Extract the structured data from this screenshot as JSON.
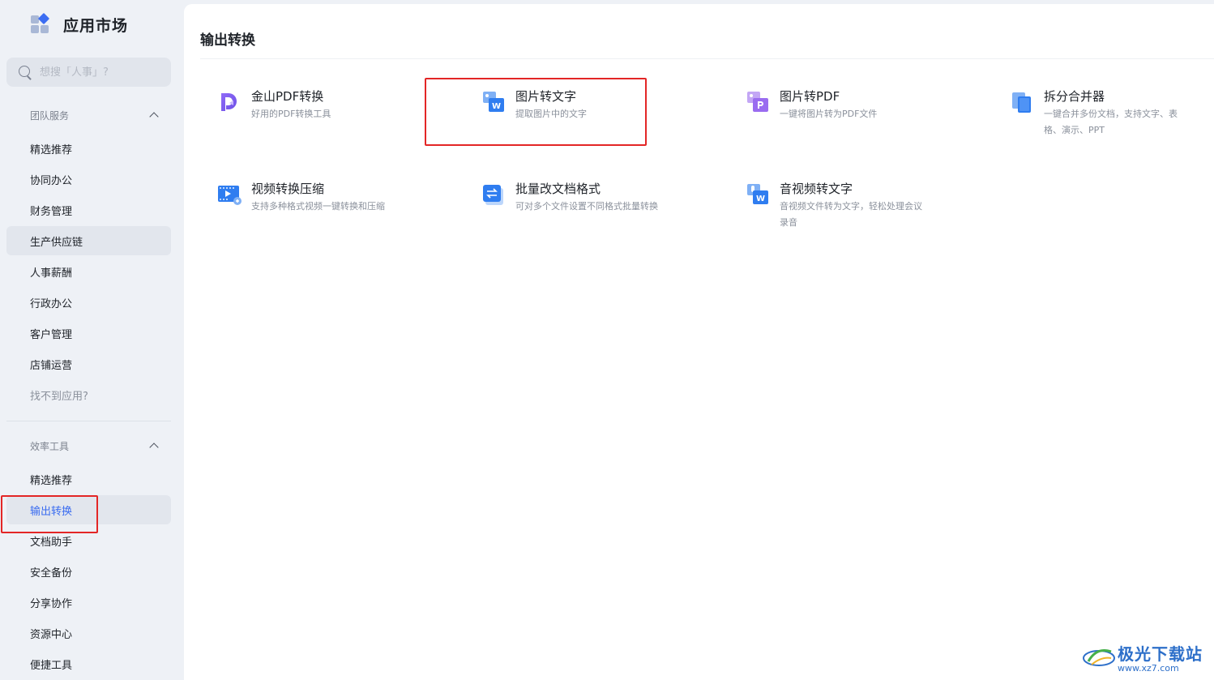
{
  "app": {
    "title": "应用市场"
  },
  "search": {
    "placeholder": "想搜「人事」?"
  },
  "sidebar": {
    "team_group": {
      "title": "团队服务",
      "items": [
        {
          "label": "精选推荐"
        },
        {
          "label": "协同办公"
        },
        {
          "label": "财务管理"
        },
        {
          "label": "生产供应链"
        },
        {
          "label": "人事薪酬"
        },
        {
          "label": "行政办公"
        },
        {
          "label": "客户管理"
        },
        {
          "label": "店铺运营"
        },
        {
          "label": "找不到应用?"
        }
      ]
    },
    "tools_group": {
      "title": "效率工具",
      "items": [
        {
          "label": "精选推荐"
        },
        {
          "label": "输出转换"
        },
        {
          "label": "文档助手"
        },
        {
          "label": "安全备份"
        },
        {
          "label": "分享协作"
        },
        {
          "label": "资源中心"
        },
        {
          "label": "便捷工具"
        }
      ]
    }
  },
  "main": {
    "title": "输出转换",
    "tools": [
      {
        "name": "金山PDF转换",
        "desc_lines": [
          "好用的PDF转换工具"
        ],
        "icon": "pdf-convert-icon"
      },
      {
        "name": "图片转文字",
        "desc_lines": [
          "提取图片中的文字"
        ],
        "icon": "image-to-text-icon"
      },
      {
        "name": "图片转PDF",
        "desc_lines": [
          "一键将图片转为PDF文件"
        ],
        "icon": "image-to-pdf-icon"
      },
      {
        "name": "拆分合并器",
        "desc_lines": [
          "一键合并多份文档，支持文字、表",
          "格、演示、PPT"
        ],
        "icon": "split-merge-icon"
      },
      {
        "name": "视频转换压缩",
        "desc_lines": [
          "支持多种格式视频一键转换和压缩"
        ],
        "icon": "video-convert-icon"
      },
      {
        "name": "批量改文档格式",
        "desc_lines": [
          "可对多个文件设置不同格式批量转换"
        ],
        "icon": "batch-format-icon"
      },
      {
        "name": "音视频转文字",
        "desc_lines": [
          "音视频文件转为文字，轻松处理会议",
          "录音"
        ],
        "icon": "audio-to-text-icon"
      }
    ]
  },
  "watermark": {
    "name": "极光下载站",
    "url": "www.xz7.com"
  },
  "colors": {
    "accent": "#3a6cf0",
    "highlight_box": "#e32626",
    "sidebar_bg": "#eef1f6"
  }
}
